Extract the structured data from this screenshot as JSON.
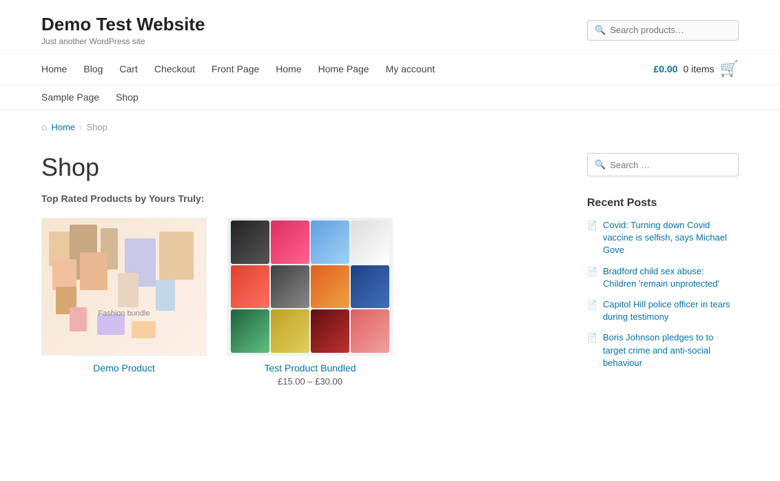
{
  "site": {
    "title": "Demo Test Website",
    "tagline": "Just another WordPress site"
  },
  "header": {
    "search_placeholder": "Search products…"
  },
  "nav_primary": {
    "items": [
      {
        "label": "Home",
        "href": "#",
        "active": false
      },
      {
        "label": "Blog",
        "href": "#",
        "active": false
      },
      {
        "label": "Cart",
        "href": "#",
        "active": false
      },
      {
        "label": "Checkout",
        "href": "#",
        "active": false
      },
      {
        "label": "Front Page",
        "href": "#",
        "active": false
      },
      {
        "label": "Home",
        "href": "#",
        "active": false
      },
      {
        "label": "Home Page",
        "href": "#",
        "active": false
      },
      {
        "label": "My account",
        "href": "#",
        "active": false
      }
    ],
    "cart": {
      "price": "£0.00",
      "items_label": "0 items"
    }
  },
  "nav_secondary": {
    "items": [
      {
        "label": "Sample Page",
        "href": "#"
      },
      {
        "label": "Shop",
        "href": "#"
      }
    ]
  },
  "breadcrumb": {
    "home_label": "Home",
    "current": "Shop"
  },
  "shop": {
    "title": "Shop",
    "subtitle": "Top Rated Products by Yours Truly:"
  },
  "products": [
    {
      "title": "Demo Product",
      "price": "",
      "type": "fashion"
    },
    {
      "title": "Test Product Bundled",
      "price": "£15.00 – £30.00",
      "type": "shoes"
    }
  ],
  "sidebar": {
    "search_placeholder": "Search …",
    "recent_posts_title": "Recent Posts",
    "recent_posts": [
      {
        "title": "Covid: Turning down Covid vaccine is selfish, says Michael Gove"
      },
      {
        "title": "Bradford child sex abuse: Children 'remain unprotected'"
      },
      {
        "title": "Capitol Hill police officer in tears during testimony"
      },
      {
        "title": "Boris Johnson pledges to to target crime and anti-social behaviour"
      }
    ]
  }
}
